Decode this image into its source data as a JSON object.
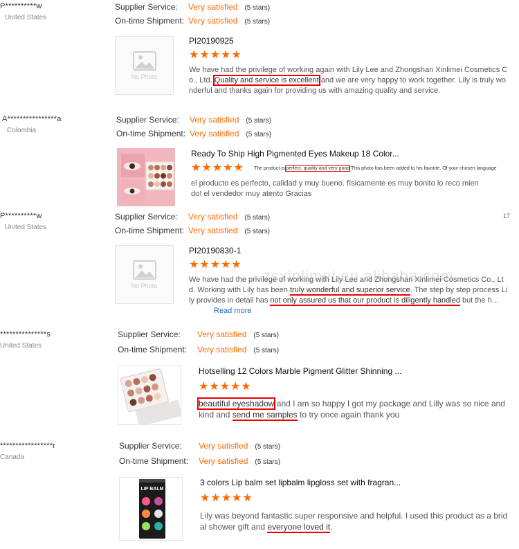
{
  "reviews": [
    {
      "buyer": "P**********w",
      "country": "United States",
      "supplier_label": "Supplier Service:",
      "supplier_value": "Very satisfied",
      "supplier_stars": "(5 stars)",
      "shipment_label": "On-time Shipment:",
      "shipment_value": "Very satisfied",
      "shipment_stars": "(5 stars)",
      "thumbnail": "No Photo",
      "product": "PI20190925",
      "stars": "★★★★★",
      "text_a": "We have had the privilege of working again with Lily Lee and Zhongshan Xinlimei Cosmetics Co., Ltd.",
      "text_b": "Quality and service is excellent",
      "text_c": "and we are very happy to work together. Lily is truly wonderful and thanks again for providing us with amazing quality and service."
    },
    {
      "buyer": "A****************a",
      "country": "Colombia",
      "supplier_label": "Supplier Service:",
      "supplier_value": "Very satisfied",
      "supplier_stars": "(5 stars)",
      "shipment_label": "On-time Shipment:",
      "shipment_value": "Very satisfied",
      "shipment_stars": "(5 stars)",
      "product": "Ready To Ship High Pigmented Eyes Makeup 18 Color...",
      "stars": "★★★★★",
      "translate_a": "The product is",
      "translate_b": "perfect, quality and very good",
      "translate_c": "This photo has been added to his favorite. Of your chosen language",
      "text": "el producto es perfecto, calidad y muy bueno.  físicamente es muy bonito lo reco miendo! el vendedor muy atento Gracias"
    },
    {
      "buyer": "P**********w",
      "country": "United States",
      "supplier_label": "Supplier Service:",
      "supplier_value": "Very satisfied",
      "supplier_stars": "(5 stars)",
      "shipment_label": "On-time Shipment:",
      "shipment_value": "Very satisfied",
      "shipment_stars": "(5 stars)",
      "thumbnail": "No Photo",
      "product": "PI20190830-1",
      "stars": "★★★★★",
      "text_a": "We have had the privilege of working with Lily Lee and Zhongshan Xinlimei Cosmetics Co., Ltd. Working with Lily has been",
      "text_b": "truly wonderful and superior service",
      "text_c": ". The step by step process Lily provides in detail has",
      "text_d": "not only assured us that our product is diligently handled",
      "text_e": "but the h...",
      "read_more": "Read more",
      "page_marker": "17"
    },
    {
      "buyer": "***************s",
      "country": "United States",
      "supplier_label": "Supplier Service:",
      "supplier_value": "Very satisfied",
      "supplier_stars": "(5 stars)",
      "shipment_label": "On-time Shipment:",
      "shipment_value": "Very satisfied",
      "shipment_stars": "(5 stars)",
      "product": "Hotselling 12 Colors Marble Pigment Glitter Shinning ...",
      "stars": "★★★★★",
      "text_a": "beautiful eyeshadow",
      "text_b": "and I am so happy I got my package and Lilly was so nice and kind and",
      "text_c": "send me samples",
      "text_d": "to try once again thank you"
    },
    {
      "buyer": "*****************r",
      "country": "Canada",
      "supplier_label": "Supplier Service:",
      "supplier_value": "Very satisfied",
      "supplier_stars": "(5 stars)",
      "shipment_label": "On-time Shipment:",
      "shipment_value": "Very satisfied",
      "shipment_stars": "(5 stars)",
      "product": "3 colors Lip balm set lipbalm lipgloss set with fragran...",
      "stars": "★★★★★",
      "package_label": "LIP BALM",
      "text_a": "Lily was beyond fantastic super responsive and helpful. I used this product as a bridal shower gift and",
      "text_b": "everyone loved it",
      "text_c": "."
    }
  ],
  "watermark": "zsxinlimei.en.alibaba.com",
  "colors": {
    "accent": "#ff6a00",
    "highlight": "#e00000",
    "link": "#1a6fb5"
  }
}
